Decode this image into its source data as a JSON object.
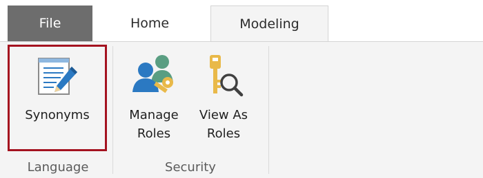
{
  "tabs": [
    {
      "label": "File"
    },
    {
      "label": "Home"
    },
    {
      "label": "Modeling"
    }
  ],
  "ribbon": {
    "synonyms_label": "Synonyms",
    "manage_roles_line1": "Manage",
    "manage_roles_line2": "Roles",
    "view_as_roles_line1": "View As",
    "view_as_roles_line2": "Roles",
    "group_language": "Language",
    "group_security": "Security"
  },
  "colors": {
    "file_tab": "#6d6d6d",
    "highlight_border": "#a4121f",
    "icon_blue": "#2b79c2",
    "icon_green": "#5a9e82",
    "icon_gold": "#e9b949"
  }
}
